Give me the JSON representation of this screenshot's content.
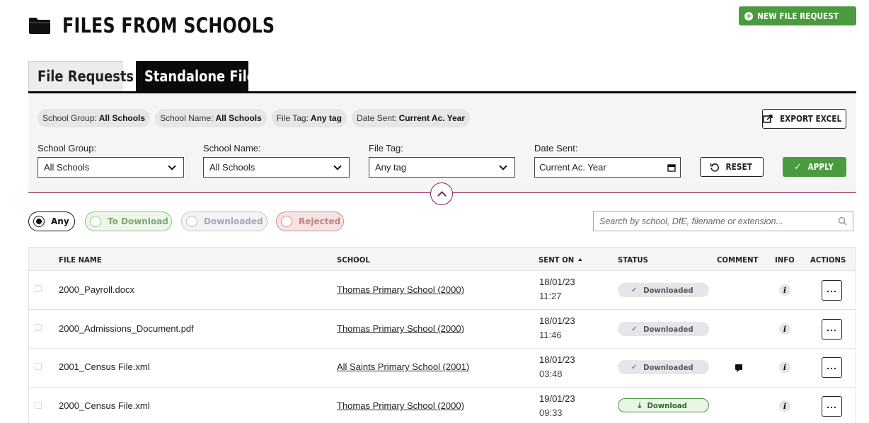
{
  "header": {
    "title": "FILES FROM SCHOOLS",
    "new_request_label": "NEW FILE REQUEST"
  },
  "tabs": [
    {
      "label": "File Requests",
      "active": false
    },
    {
      "label": "Standalone Files",
      "active": true
    }
  ],
  "filters": {
    "chips": [
      {
        "key": "School Group:",
        "value": "All Schools"
      },
      {
        "key": "School Name:",
        "value": "All Schools"
      },
      {
        "key": "File Tag:",
        "value": "Any tag"
      },
      {
        "key": "Date Sent:",
        "value": "Current Ac. Year"
      }
    ],
    "export_label": "EXPORT EXCEL",
    "fields": {
      "school_group": {
        "label": "School Group:",
        "value": "All Schools"
      },
      "school_name": {
        "label": "School Name:",
        "value": "All Schools"
      },
      "file_tag": {
        "label": "File Tag:",
        "value": "Any tag"
      },
      "date_sent": {
        "label": "Date Sent:",
        "value": "Current Ac. Year"
      }
    },
    "reset_label": "RESET",
    "apply_label": "APPLY"
  },
  "status_filter": {
    "options": [
      "Any",
      "To Download",
      "Downloaded",
      "Rejected"
    ],
    "selected": "Any"
  },
  "search": {
    "placeholder": "Search by school, DfE, filename or extension..."
  },
  "table": {
    "columns": [
      "FILE NAME",
      "SCHOOL",
      "SENT ON",
      "STATUS",
      "COMMENT",
      "INFO",
      "ACTIONS"
    ],
    "sort_column": "SENT ON",
    "rows": [
      {
        "file": "2000_Payroll.docx",
        "school": "Thomas Primary School (2000)",
        "date": "18/01/23",
        "time": "11:27",
        "status": "Downloaded",
        "comment": false
      },
      {
        "file": "2000_Admissions_Document.pdf",
        "school": "Thomas Primary School (2000)",
        "date": "18/01/23",
        "time": "11:46",
        "status": "Downloaded",
        "comment": false
      },
      {
        "file": "2001_Census File.xml",
        "school": "All Saints Primary School (2001)",
        "date": "18/01/23",
        "time": "03:48",
        "status": "Downloaded",
        "comment": true
      },
      {
        "file": "2000_Census File.xml",
        "school": "Thomas Primary School (2000)",
        "date": "19/01/23",
        "time": "09:33",
        "status": "Download",
        "comment": false
      }
    ],
    "info_glyph": "i",
    "actions_glyph": "..."
  },
  "icons": {
    "folder": "folder-icon",
    "plus": "plus-circle-icon",
    "export": "external-link-icon",
    "reset": "refresh-icon",
    "apply": "check-icon",
    "collapse": "chevron-up-icon",
    "search": "search-icon",
    "calendar": "calendar-icon",
    "comment": "comment-icon",
    "info": "info-icon",
    "download": "download-icon"
  },
  "colors": {
    "accent_green": "#4a9a3f",
    "accent_maroon": "#8b2457",
    "tab_active_bg": "#0a0a0a"
  }
}
